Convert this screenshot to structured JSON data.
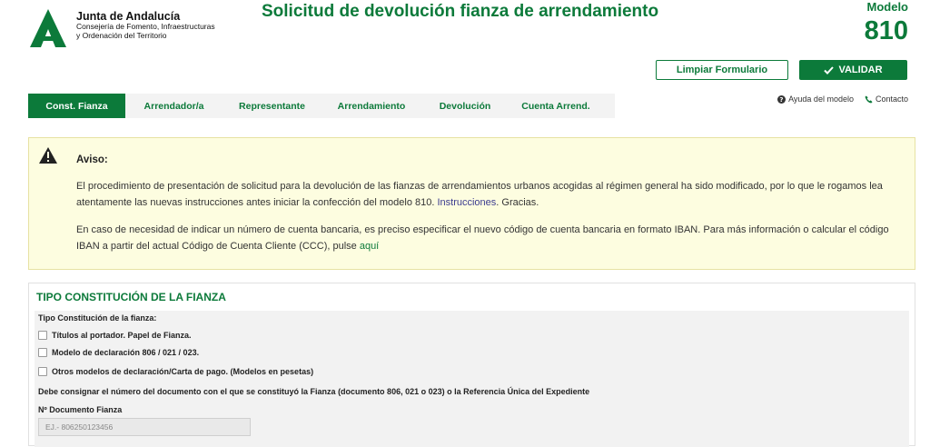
{
  "header": {
    "org_name": "Junta de Andalucía",
    "org_sub_1": "Consejería de Fomento, Infraestructuras",
    "org_sub_2": "y Ordenación del Territorio",
    "title": "Solicitud de devolución fianza de arrendamiento",
    "modelo_label": "Modelo",
    "modelo_number": "810",
    "brand_color": "#0c7a3a"
  },
  "actions": {
    "limpiar_label": "Limpiar Formulario",
    "validar_label": "VALIDAR"
  },
  "help": {
    "ayuda_label": "Ayuda del modelo",
    "contacto_label": "Contacto"
  },
  "tabs": [
    {
      "label": "Const. Fianza",
      "active": true
    },
    {
      "label": "Arrendador/a",
      "active": false
    },
    {
      "label": "Representante",
      "active": false
    },
    {
      "label": "Arrendamiento",
      "active": false
    },
    {
      "label": "Devolución",
      "active": false
    },
    {
      "label": "Cuenta Arrend.",
      "active": false
    }
  ],
  "notice": {
    "title": "Aviso:",
    "p1": "El procedimiento de presentación de solicitud para la devolución de las fianzas de arrendamientos urbanos acogidas al régimen general ha sido modificado, por lo que le rogamos lea atentamente las nuevas instrucciones antes iniciar la confección del modelo 810.",
    "p1_link": "Instrucciones",
    "p1_end": ". Gracias.",
    "p2": "En caso de necesidad de indicar un número de cuenta bancaria, es preciso especificar el nuevo código de cuenta bancaria en formato IBAN. Para más información o calcular el código IBAN a partir del actual Código de Cuenta Cliente (CCC), pulse",
    "p2_link": "aquí"
  },
  "section": {
    "title": "TIPO CONSTITUCIÓN DE LA FIANZA",
    "tipo_label": "Tipo Constitución de la fianza:",
    "options": [
      "Títulos al portador. Papel de Fianza.",
      "Modelo de declaración 806 / 021 / 023.",
      "Otros modelos de declaración/Carta de pago. (Modelos en pesetas)"
    ],
    "instruction": "Debe consignar el número del documento con el que se constituyó la Fianza (documento 806, 021 o 023) o la Referencia Única del Expediente",
    "doc_label": "Nº Documento Fianza",
    "doc_placeholder": "EJ.- 806250123456"
  }
}
